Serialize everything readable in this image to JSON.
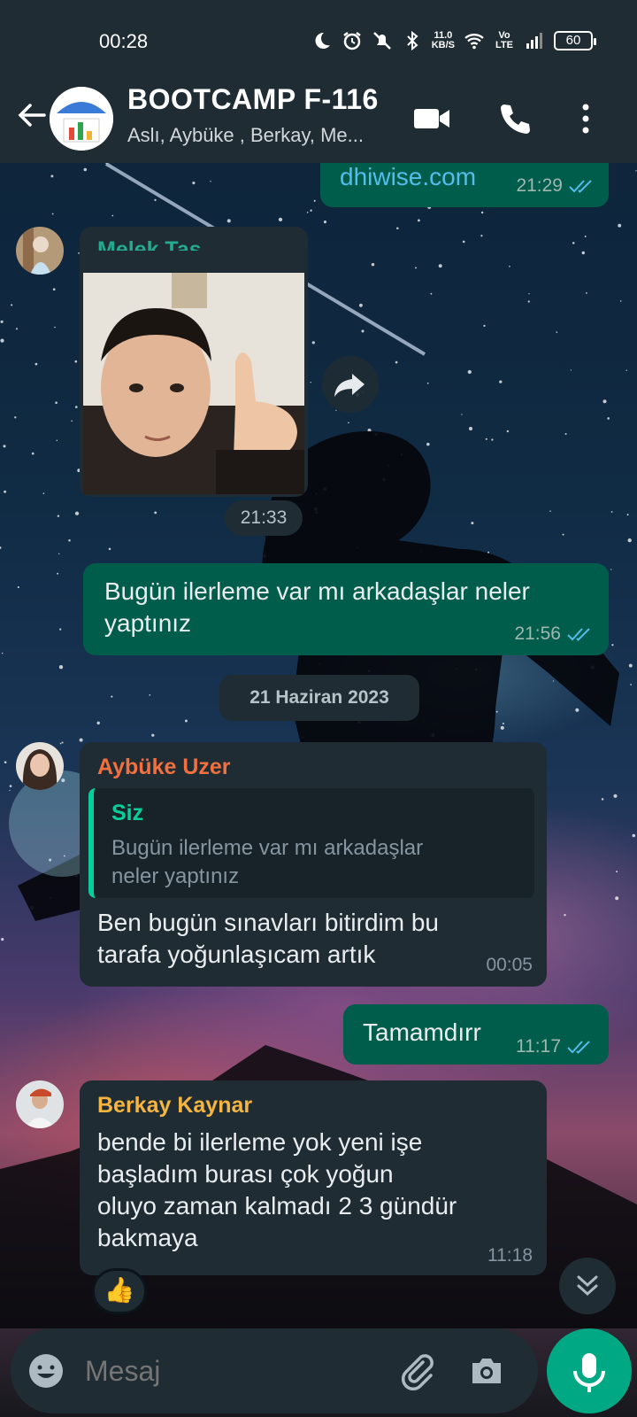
{
  "status_bar": {
    "time": "00:28",
    "net_speed_value": "11.0",
    "net_speed_unit": "KB/S",
    "volte": "Vo LTE",
    "battery": "60"
  },
  "header": {
    "title": "BOOTCAMP F-116",
    "subtitle": "Aslı, Aybüke , Berkay, Me..."
  },
  "messages": {
    "m0": {
      "text": "dhiwise.com",
      "time": "21:29"
    },
    "m1": {
      "sender": "Melek Taş",
      "time": "21:33"
    },
    "m2": {
      "text_line1": "Bugün ilerleme var mı arkadaşlar neler",
      "text_line2": "yaptınız",
      "time": "21:56"
    },
    "date_separator": "21 Haziran 2023",
    "m3": {
      "sender": "Aybüke Uzer",
      "quote_name": "Siz",
      "quote_line1": "Bugün ilerleme var mı arkadaşlar",
      "quote_line2": "neler yaptınız",
      "text_line1": "Ben bugün sınavları bitirdim bu",
      "text_line2": "tarafa yoğunlaşıcam artık",
      "time": "00:05"
    },
    "m4": {
      "text": "Tamamdırr",
      "time": "11:17"
    },
    "m5": {
      "sender": "Berkay Kaynar",
      "text_line1": "bende bi ilerleme yok yeni işe",
      "text_line2": "başladım burası çok yoğun",
      "text_line3": "oluyo zaman kalmadı 2 3 gündür",
      "text_line4": "bakmaya",
      "time": "11:18",
      "reaction": "👍"
    }
  },
  "input": {
    "placeholder": "Mesaj"
  },
  "colors": {
    "header_bg": "#1f2c34",
    "outgoing_bubble": "#005c4b",
    "incoming_bubble": "#1f2c34",
    "accent_green": "#00a884",
    "sender_melek": "#25a98f",
    "sender_aybuke": "#f2703e",
    "sender_berkay": "#f5b53f",
    "link_color": "#53bdeb",
    "read_ticks": "#53bdeb"
  },
  "icons": {
    "back": "arrow-left-icon",
    "video": "video-call-icon",
    "call": "phone-icon",
    "menu": "more-vert-icon",
    "forward": "forward-icon",
    "scroll_down": "double-chevron-down-icon",
    "emoji": "emoji-icon",
    "attach": "paperclip-icon",
    "camera": "camera-icon",
    "mic": "mic-icon"
  }
}
